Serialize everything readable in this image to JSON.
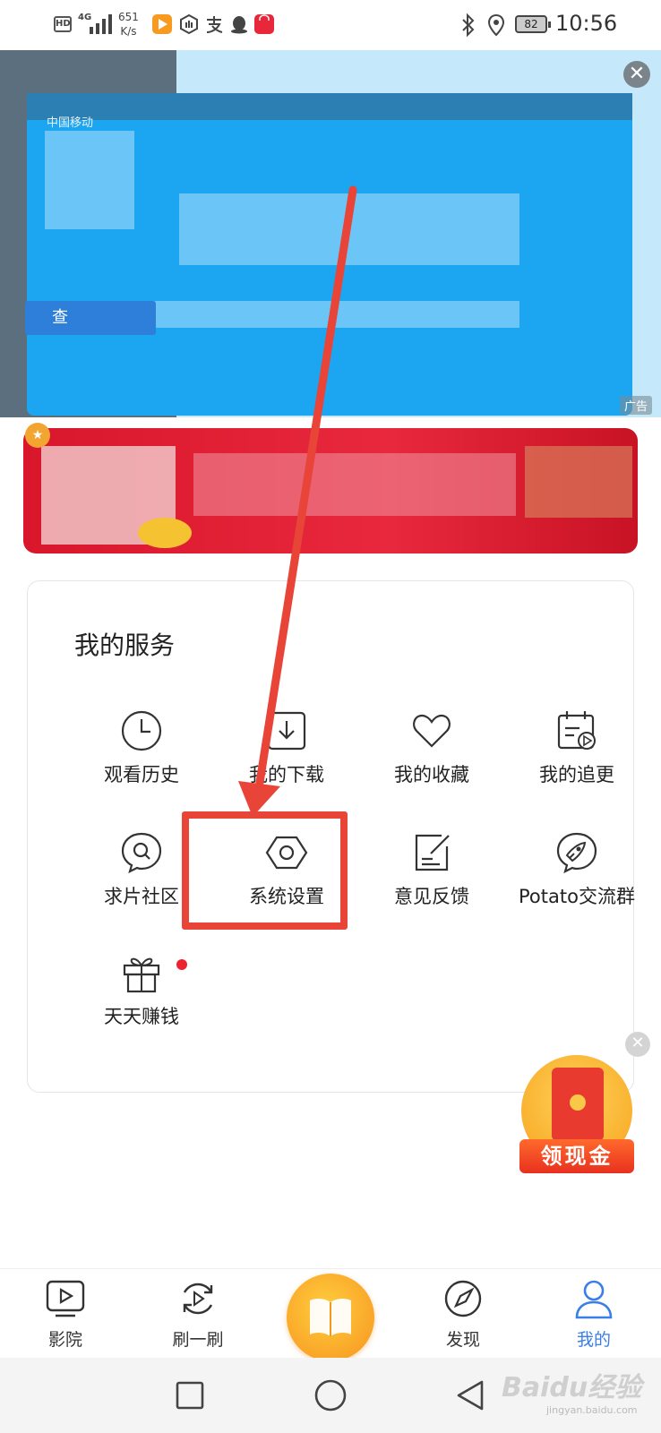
{
  "status_bar": {
    "hd_label": "HD",
    "network_label": "4G",
    "speed_value": "651",
    "speed_unit": "K/s",
    "battery": "82",
    "time": "10:56"
  },
  "ad": {
    "brand": "中国移动",
    "query_button": "查",
    "ad_tag": "广告",
    "close_symbol": "✕"
  },
  "services": {
    "title": "我的服务",
    "items": [
      {
        "label": "观看历史",
        "icon": "clock-icon"
      },
      {
        "label": "我的下载",
        "icon": "download-icon"
      },
      {
        "label": "我的收藏",
        "icon": "heart-icon"
      },
      {
        "label": "我的追更",
        "icon": "calendar-play-icon"
      },
      {
        "label": "求片社区",
        "icon": "search-chat-icon"
      },
      {
        "label": "系统设置",
        "icon": "settings-hexagon-icon"
      },
      {
        "label": "意见反馈",
        "icon": "feedback-edit-icon"
      },
      {
        "label": "Potato交流群",
        "icon": "rocket-chat-icon"
      },
      {
        "label": "天天赚钱",
        "icon": "gift-icon"
      }
    ]
  },
  "floating_packet": {
    "label": "领现金",
    "close_symbol": "✕"
  },
  "bottom_nav": {
    "items": [
      {
        "label": "影院",
        "icon": "play-screen-icon"
      },
      {
        "label": "刷一刷",
        "icon": "refresh-play-icon"
      },
      {
        "label": "发现",
        "icon": "compass-icon"
      },
      {
        "label": "我的",
        "icon": "person-icon"
      }
    ],
    "active_color": "#3a7ee8"
  },
  "watermark": {
    "main": "Baidu经验",
    "sub": "jingyan.baidu.com"
  }
}
